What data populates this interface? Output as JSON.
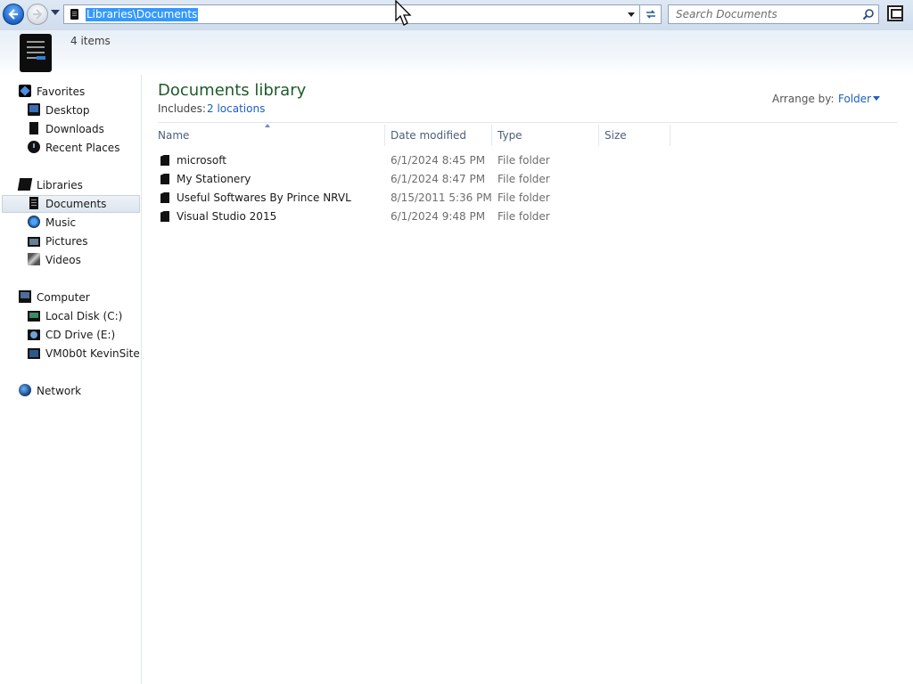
{
  "address": {
    "path": "Libraries\\Documents",
    "icon": "documents-library-icon"
  },
  "search": {
    "placeholder": "Search Documents",
    "icon": "search-icon"
  },
  "details": {
    "item_count": "4 items"
  },
  "nav": {
    "favorites": {
      "label": "Favorites",
      "items": [
        {
          "label": "Desktop",
          "icon": "desktop-icon"
        },
        {
          "label": "Downloads",
          "icon": "downloads-icon"
        },
        {
          "label": "Recent Places",
          "icon": "recent-places-icon"
        }
      ]
    },
    "libraries": {
      "label": "Libraries",
      "items": [
        {
          "label": "Documents",
          "icon": "documents-icon",
          "selected": true
        },
        {
          "label": "Music",
          "icon": "music-icon"
        },
        {
          "label": "Pictures",
          "icon": "pictures-icon"
        },
        {
          "label": "Videos",
          "icon": "videos-icon"
        }
      ]
    },
    "computer": {
      "label": "Computer",
      "items": [
        {
          "label": "Local Disk (C:)",
          "icon": "local-disk-icon"
        },
        {
          "label": "CD Drive (E:)",
          "icon": "cd-drive-icon"
        },
        {
          "label": "VM0b0t KevinSite",
          "icon": "network-drive-icon"
        }
      ]
    },
    "network": {
      "label": "Network",
      "icon": "network-icon"
    }
  },
  "library": {
    "title": "Documents library",
    "includes_label": "Includes:",
    "includes_link": "2 locations",
    "arrange_label": "Arrange by:",
    "arrange_value": "Folder"
  },
  "columns": [
    "Name",
    "Date modified",
    "Type",
    "Size"
  ],
  "files": [
    {
      "name": "microsoft",
      "date": "6/1/2024 8:45 PM",
      "type": "File folder",
      "size": ""
    },
    {
      "name": "My Stationery",
      "date": "6/1/2024 8:47 PM",
      "type": "File folder",
      "size": ""
    },
    {
      "name": "Useful Softwares By Prince NRVL",
      "date": "8/15/2011 5:36 PM",
      "type": "File folder",
      "size": ""
    },
    {
      "name": "Visual Studio 2015",
      "date": "6/1/2024 9:48 PM",
      "type": "File folder",
      "size": ""
    }
  ],
  "colors": {
    "title_green": "#1e5b2a",
    "link_blue": "#1a5fc0",
    "selection_blue": "#3399ff"
  }
}
